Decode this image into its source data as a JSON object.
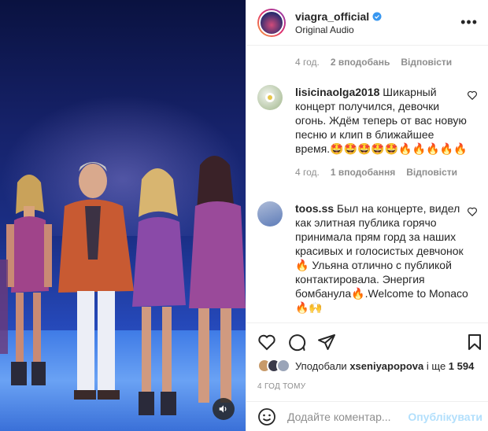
{
  "header": {
    "username": "viagra_official",
    "subtitle": "Original Audio",
    "more_icon": "more-horizontal-icon"
  },
  "first_meta": {
    "time": "4 год.",
    "likes": "2 вподобань",
    "reply": "Відповісти"
  },
  "comments": [
    {
      "user": "lisicinaolga2018",
      "text": "Шикарный концерт получился, девочки огонь. Ждём теперь от вас новую песню и клип в ближайшее время.🤩🤩🤩🤩🤩🔥🔥🔥🔥🔥",
      "time": "4 год.",
      "likes": "1 вподобання",
      "reply": "Відповісти"
    },
    {
      "user": "toos.ss",
      "text": "Был на концерте, видел как элитная публика горячо принимала прям горд за наших красивых и голосистых девчонок🔥 Ульяна отлично с публикой контактировала. Энергия бомбанула🔥.Welcome to Monaco🔥🙌"
    }
  ],
  "likes": {
    "prefix": "Уподобали",
    "user": "xseniyapopova",
    "middle": "і ще",
    "count": "1 594"
  },
  "timestamp": "4 ГОД ТОМУ",
  "add_comment": {
    "emoji_icon": "smiley-icon",
    "placeholder": "Додайте коментар...",
    "post_label": "Опублікувати"
  },
  "colors": {
    "accent": "#0095f6",
    "post_disabled": "#b2dffc",
    "secondary_text": "#8e8e8e"
  }
}
